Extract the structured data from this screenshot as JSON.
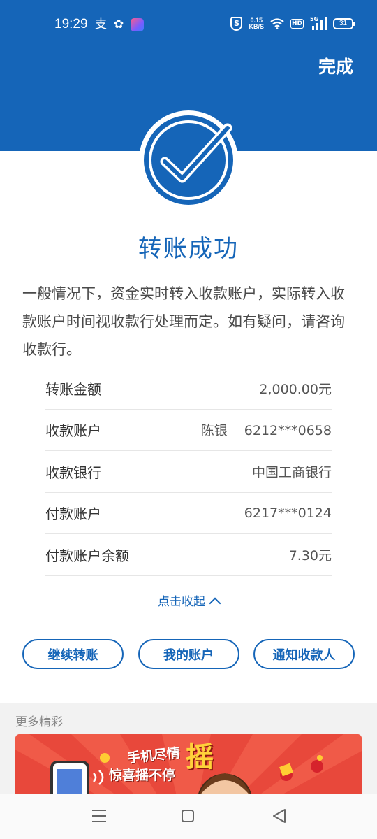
{
  "status_bar": {
    "time": "19:29",
    "left_icons": [
      "alipay-icon",
      "uc-icon",
      "app-icon"
    ],
    "net_speed_value": "0.15",
    "net_speed_unit": "KB/S",
    "hd": "HD",
    "network": "5G",
    "battery": "31"
  },
  "header": {
    "done_label": "完成",
    "brand_color": "#1565b8"
  },
  "result": {
    "title": "转账成功",
    "description": "一般情况下，资金实时转入收款账户，实际转入收款账户时间视收款行处理而定。如有疑问，请咨询收款行。"
  },
  "details": [
    {
      "label": "转账金额",
      "value": "2,000.00元"
    },
    {
      "label": "收款账户",
      "name": "陈银",
      "value": "6212***0658"
    },
    {
      "label": "收款银行",
      "value": "中国工商银行"
    },
    {
      "label": "付款账户",
      "value": "6217***0124"
    },
    {
      "label": "付款账户余额",
      "value": "7.30元"
    }
  ],
  "collapse_label": "点击收起",
  "actions": {
    "continue": "继续转账",
    "my_account": "我的账户",
    "notify": "通知收款人"
  },
  "more": {
    "title": "更多精彩",
    "banner_line1": "手机尽情",
    "banner_big": "摇",
    "banner_line2": "惊喜摇不停"
  }
}
